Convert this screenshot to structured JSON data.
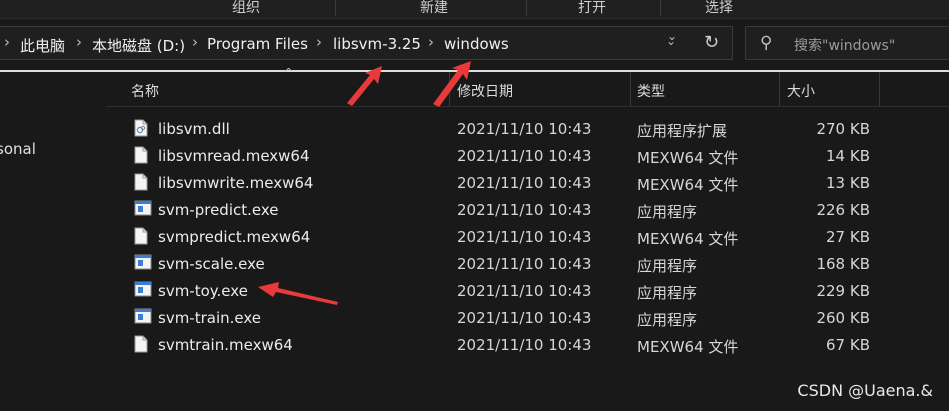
{
  "ribbon": {
    "groups": [
      "组织",
      "新建",
      "打开",
      "选择"
    ]
  },
  "address": {
    "crumbs": [
      "此电脑",
      "本地磁盘 (D:)",
      "Program Files",
      "libsvm-3.25",
      "windows"
    ]
  },
  "search": {
    "placeholder": "搜索\"windows\""
  },
  "nav": {
    "partial_item": "sonal"
  },
  "columns": {
    "name": "名称",
    "date": "修改日期",
    "type": "类型",
    "size": "大小"
  },
  "files": [
    {
      "name": "libsvm.dll",
      "date": "2021/11/10 10:43",
      "type": "应用程序扩展",
      "size": "270 KB",
      "icon": "dll-file-icon"
    },
    {
      "name": "libsvmread.mexw64",
      "date": "2021/11/10 10:43",
      "type": "MEXW64 文件",
      "size": "14 KB",
      "icon": "generic-file-icon"
    },
    {
      "name": "libsvmwrite.mexw64",
      "date": "2021/11/10 10:43",
      "type": "MEXW64 文件",
      "size": "13 KB",
      "icon": "generic-file-icon"
    },
    {
      "name": "svm-predict.exe",
      "date": "2021/11/10 10:43",
      "type": "应用程序",
      "size": "226 KB",
      "icon": "exe-file-icon"
    },
    {
      "name": "svmpredict.mexw64",
      "date": "2021/11/10 10:43",
      "type": "MEXW64 文件",
      "size": "27 KB",
      "icon": "generic-file-icon"
    },
    {
      "name": "svm-scale.exe",
      "date": "2021/11/10 10:43",
      "type": "应用程序",
      "size": "168 KB",
      "icon": "exe-file-icon"
    },
    {
      "name": "svm-toy.exe",
      "date": "2021/11/10 10:43",
      "type": "应用程序",
      "size": "229 KB",
      "icon": "exe-file-icon"
    },
    {
      "name": "svm-train.exe",
      "date": "2021/11/10 10:43",
      "type": "应用程序",
      "size": "260 KB",
      "icon": "exe-file-icon"
    },
    {
      "name": "svmtrain.mexw64",
      "date": "2021/11/10 10:43",
      "type": "MEXW64 文件",
      "size": "67 KB",
      "icon": "generic-file-icon"
    }
  ],
  "watermark": "CSDN @Uaena.&",
  "colors": {
    "background": "#191919",
    "annotation_arrow": "#e83a3a",
    "exe_icon_blue": "#3b7fd4"
  }
}
